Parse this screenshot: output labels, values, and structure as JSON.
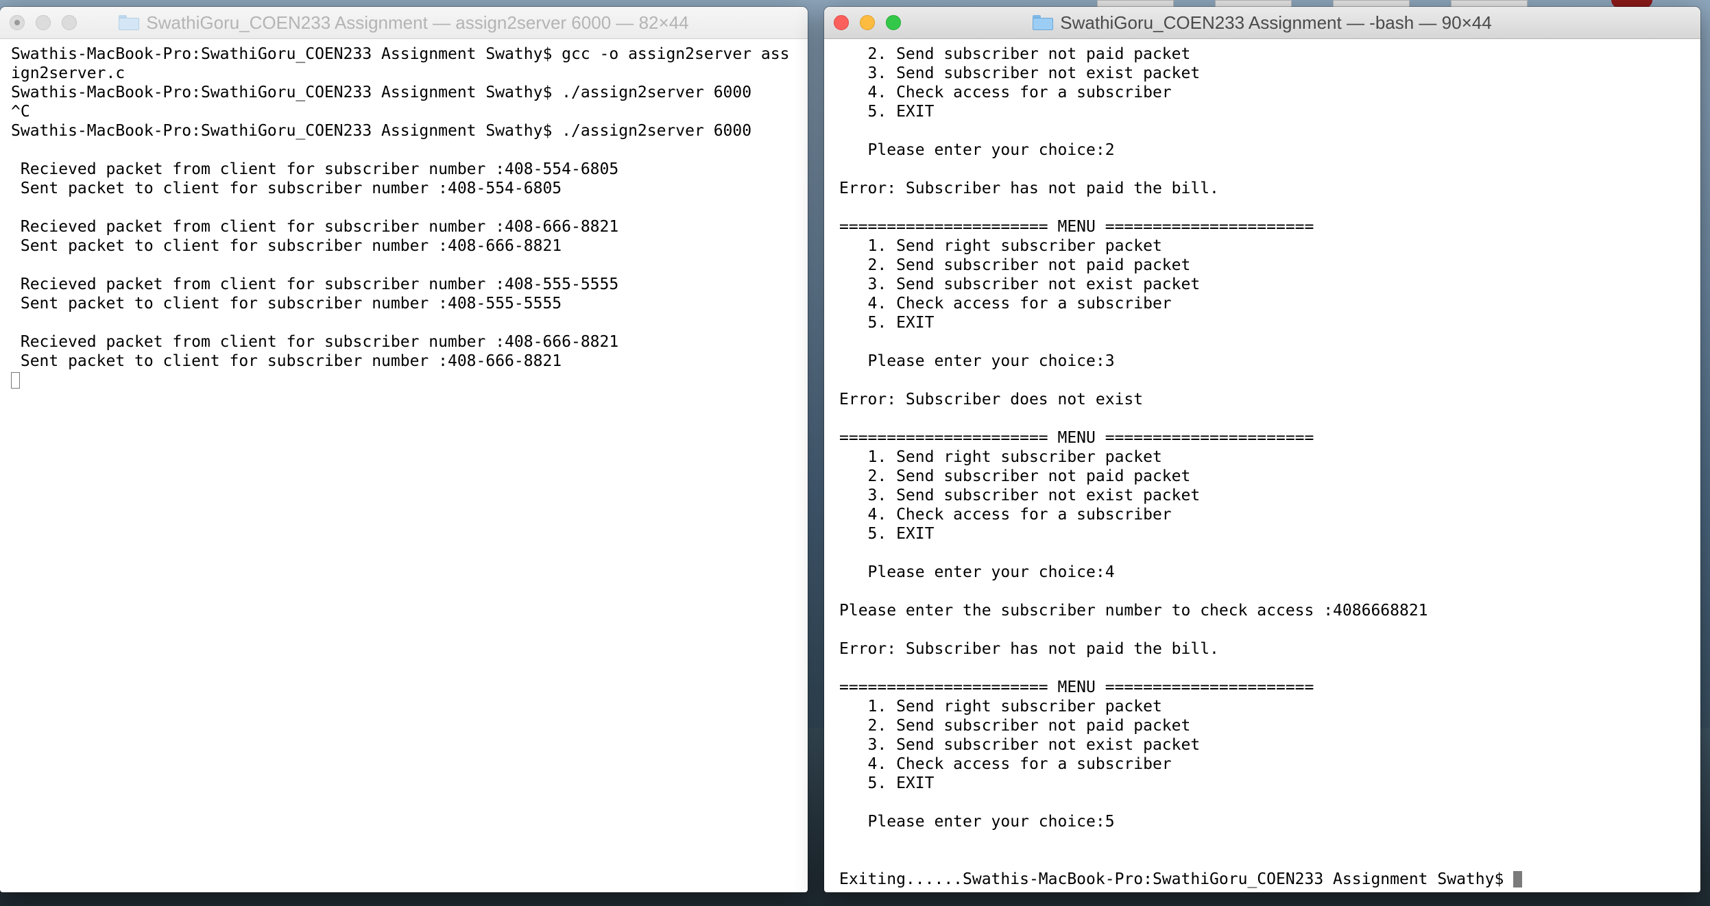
{
  "left_window": {
    "title": "SwathiGoru_COEN233 Assignment — assign2server 6000 — 82×44",
    "lines": [
      "Swathis-MacBook-Pro:SwathiGoru_COEN233 Assignment Swathy$ gcc -o assign2server ass",
      "ign2server.c",
      "Swathis-MacBook-Pro:SwathiGoru_COEN233 Assignment Swathy$ ./assign2server 6000",
      "^C",
      "Swathis-MacBook-Pro:SwathiGoru_COEN233 Assignment Swathy$ ./assign2server 6000",
      "",
      " Recieved packet from client for subscriber number :408-554-6805",
      " Sent packet to client for subscriber number :408-554-6805",
      "",
      " Recieved packet from client for subscriber number :408-666-8821",
      " Sent packet to client for subscriber number :408-666-8821",
      "",
      " Recieved packet from client for subscriber number :408-555-5555",
      " Sent packet to client for subscriber number :408-555-5555",
      "",
      " Recieved packet from client for subscriber number :408-666-8821",
      " Sent packet to client for subscriber number :408-666-8821"
    ]
  },
  "right_window": {
    "title": "SwathiGoru_COEN233 Assignment — -bash — 90×44",
    "lines": [
      "   2. Send subscriber not paid packet",
      "   3. Send subscriber not exist packet",
      "   4. Check access for a subscriber",
      "   5. EXIT",
      "",
      "   Please enter your choice:2",
      "",
      "Error: Subscriber has not paid the bill.",
      "",
      "====================== MENU ======================",
      "   1. Send right subscriber packet",
      "   2. Send subscriber not paid packet",
      "   3. Send subscriber not exist packet",
      "   4. Check access for a subscriber",
      "   5. EXIT",
      "",
      "   Please enter your choice:3",
      "",
      "Error: Subscriber does not exist",
      "",
      "====================== MENU ======================",
      "   1. Send right subscriber packet",
      "   2. Send subscriber not paid packet",
      "   3. Send subscriber not exist packet",
      "   4. Check access for a subscriber",
      "   5. EXIT",
      "",
      "   Please enter your choice:4",
      "",
      "Please enter the subscriber number to check access :4086668821",
      "",
      "Error: Subscriber has not paid the bill.",
      "",
      "====================== MENU ======================",
      "   1. Send right subscriber packet",
      "   2. Send subscriber not paid packet",
      "   3. Send subscriber not exist packet",
      "   4. Check access for a subscriber",
      "   5. EXIT",
      "",
      "   Please enter your choice:5",
      "",
      ""
    ],
    "prompt_line": "Exiting......Swathis-MacBook-Pro:SwathiGoru_COEN233 Assignment Swathy$ "
  }
}
